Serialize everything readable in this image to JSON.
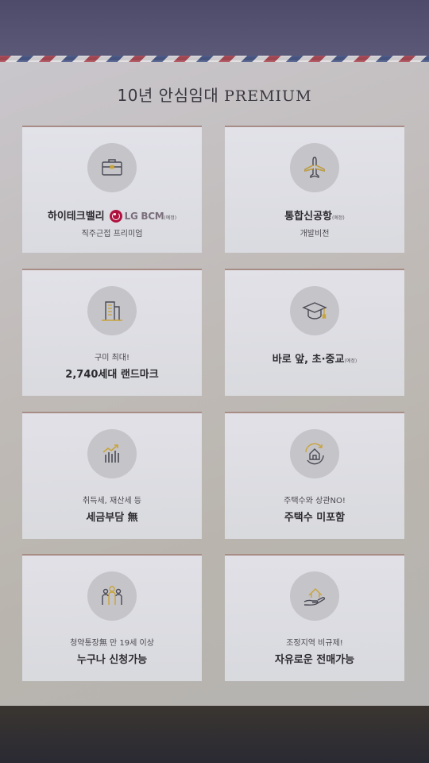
{
  "header": {
    "title_kr": "10년 안심임대",
    "title_en": "PREMIUM"
  },
  "cards": [
    {
      "icon": "briefcase-icon",
      "main": "하이테크밸리",
      "logo_text": "LG BCM",
      "tag": "(예정)",
      "sub": "직주근접 프리미엄"
    },
    {
      "icon": "airplane-icon",
      "main": "통합신공항",
      "tag": "(예정)",
      "sub": "개발비전"
    },
    {
      "icon": "building-icon",
      "sub_top": "구미 최대!",
      "main": "2,740세대 랜드마크"
    },
    {
      "icon": "graduation-cap-icon",
      "main": "바로 앞, 초·중교",
      "tag": "(예정)"
    },
    {
      "icon": "tax-chart-icon",
      "sub_top": "취득세, 재산세 등",
      "main": "세금부담 無"
    },
    {
      "icon": "house-cycle-icon",
      "sub_top": "주택수와 상관NO!",
      "main": "주택수 미포함"
    },
    {
      "icon": "people-icon",
      "sub_top": "청약통장無 만 19세 이상",
      "main": "누구나 신청가능"
    },
    {
      "icon": "house-hand-icon",
      "sub_top": "조정지역 비규제!",
      "main": "자유로운 전매가능"
    }
  ],
  "colors": {
    "accent_gold": "#c9a43a",
    "icon_line": "#4a4a55",
    "lg_brand": "#b0123f"
  }
}
